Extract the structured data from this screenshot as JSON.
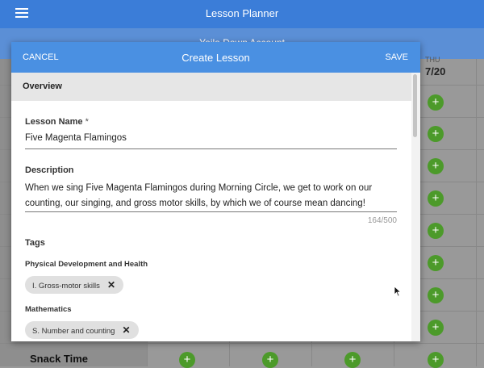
{
  "app": {
    "title": "Lesson Planner",
    "subtitle": "Yaila Dawn Account"
  },
  "calendar": {
    "day_abbrev": "THU",
    "date": "7/20",
    "row_label": "Snack Time",
    "add_symbol": "+"
  },
  "modal": {
    "cancel_label": "CANCEL",
    "title": "Create Lesson",
    "save_label": "SAVE",
    "section": "Overview",
    "lesson_name": {
      "label": "Lesson Name",
      "required_mark": "*",
      "value": "Five Magenta Flamingos"
    },
    "description": {
      "label": "Description",
      "value": "When we sing Five Magenta Flamingos during Morning Circle, we get to work on our counting, our singing, and gross motor skills, by which we of course mean dancing!",
      "counter": "164/500"
    },
    "tags": {
      "label": "Tags",
      "groups": [
        {
          "name": "Physical Development and Health",
          "chips": [
            "I. Gross-motor skills"
          ]
        },
        {
          "name": "Mathematics",
          "chips": [
            "S. Number and counting"
          ]
        }
      ],
      "remove_symbol": "✕"
    }
  },
  "colors": {
    "app_bar": "#3b7dd8",
    "modal_header": "#4a90e2",
    "add_button": "#4c9a2a"
  }
}
